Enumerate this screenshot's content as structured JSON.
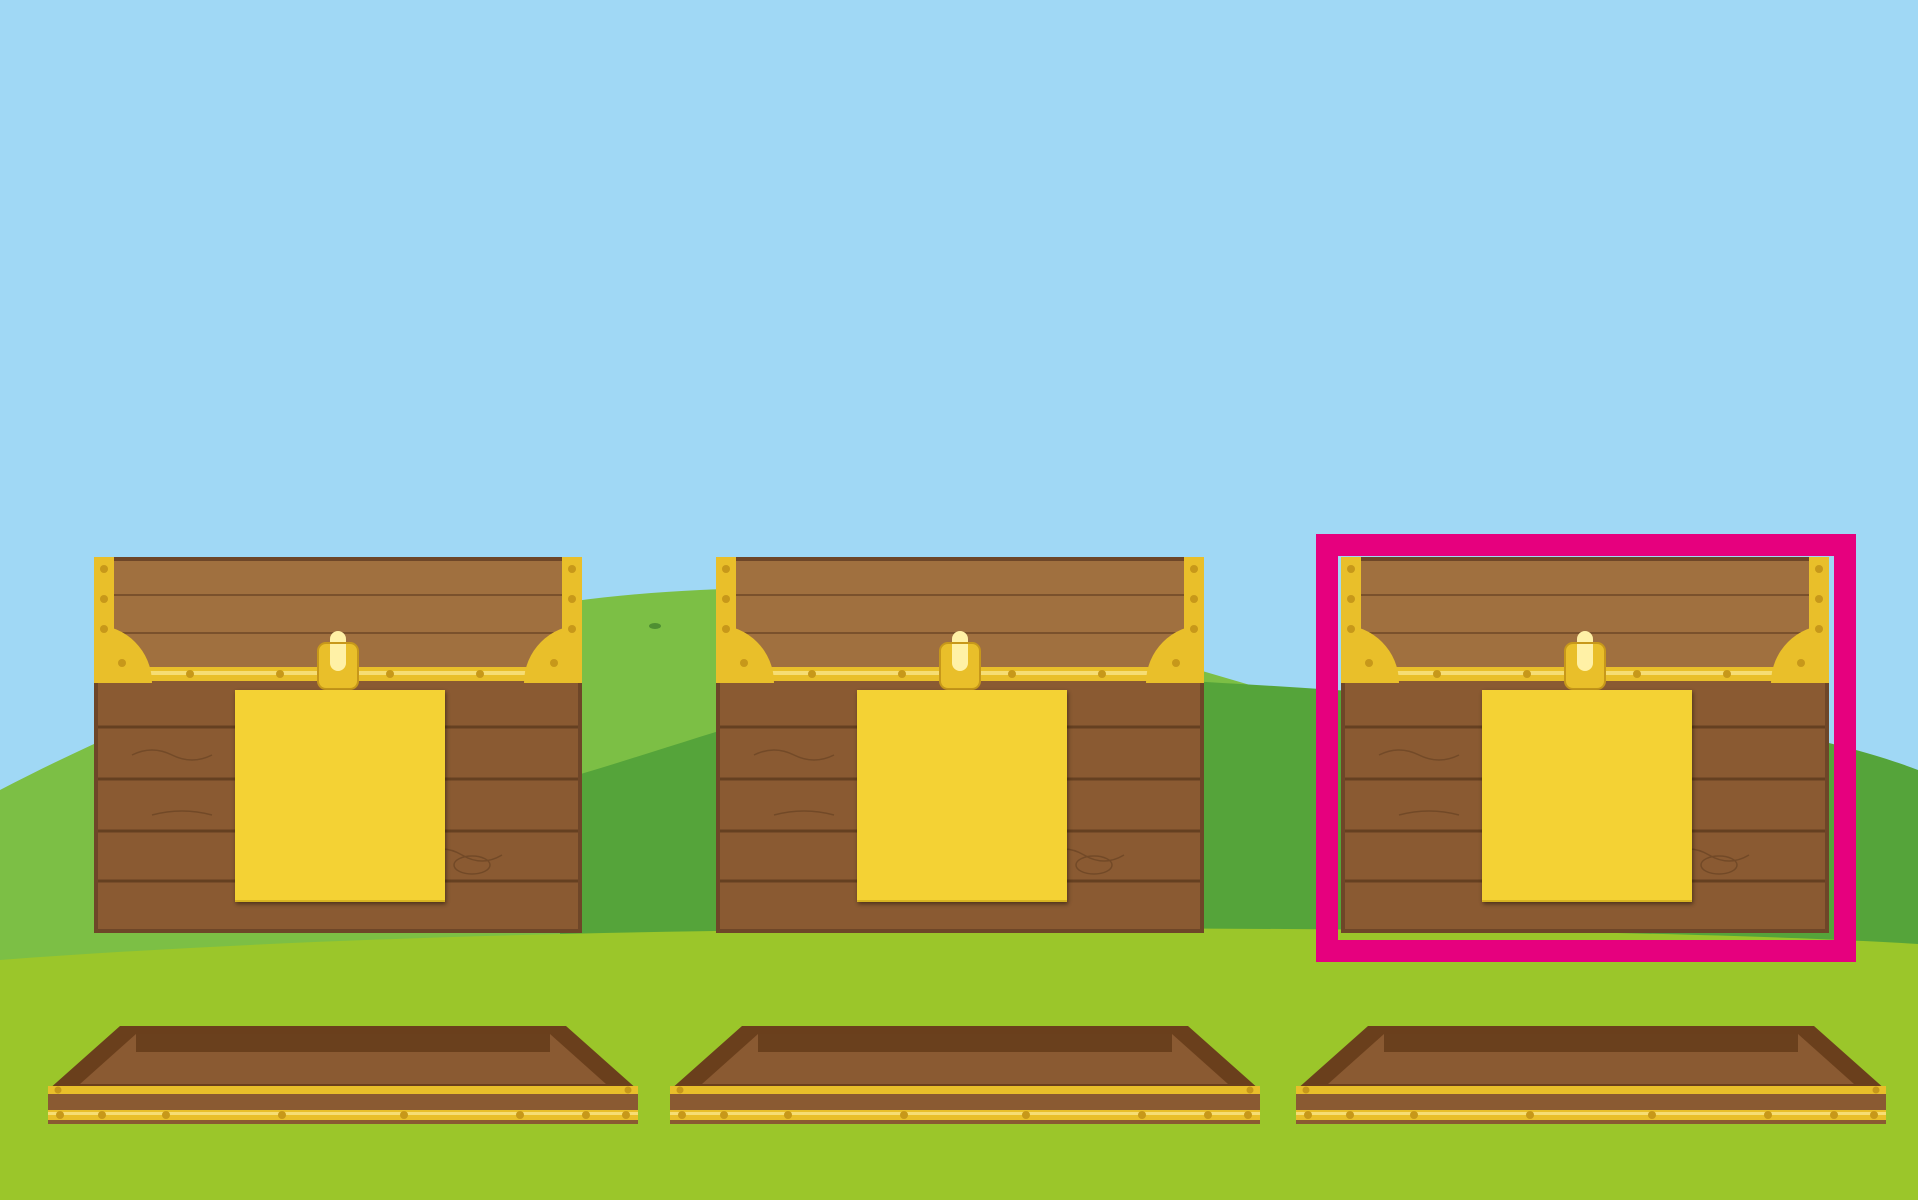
{
  "scene": {
    "colors": {
      "sky": "#a0d8f5",
      "hill_back": "#7cbf45",
      "hill_mid": "#55a43a",
      "ground": "#9bc62a",
      "wood": "#8a5a32",
      "gold": "#e9bf2a",
      "label": "#f4d234",
      "selection": "#e6007e"
    }
  },
  "chests": [
    {
      "id": "chest-1",
      "label_text": "",
      "selected": false,
      "icon": "treasure-chest-icon"
    },
    {
      "id": "chest-2",
      "label_text": "",
      "selected": false,
      "icon": "treasure-chest-icon"
    },
    {
      "id": "chest-3",
      "label_text": "",
      "selected": true,
      "icon": "treasure-chest-icon"
    }
  ],
  "trays": [
    {
      "id": "tray-1",
      "icon": "open-tray-icon"
    },
    {
      "id": "tray-2",
      "icon": "open-tray-icon"
    },
    {
      "id": "tray-3",
      "icon": "open-tray-icon"
    }
  ]
}
